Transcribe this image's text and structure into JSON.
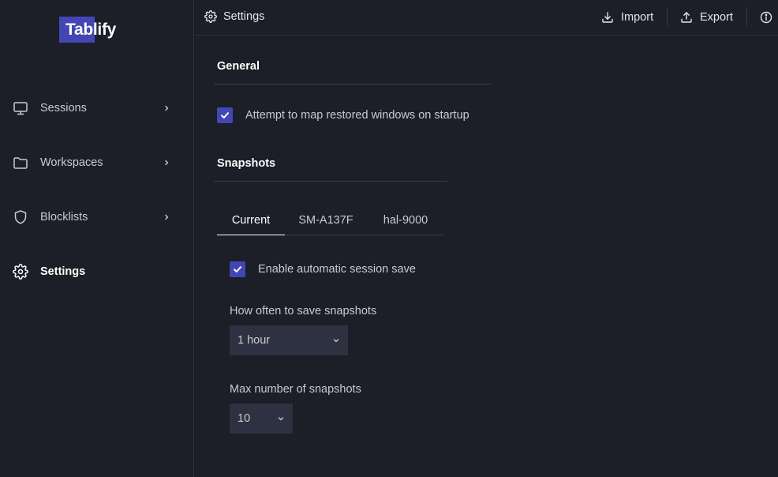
{
  "app": {
    "logo": "Tablify"
  },
  "sidebar": {
    "items": [
      {
        "label": "Sessions",
        "icon": "monitor-icon"
      },
      {
        "label": "Workspaces",
        "icon": "folder-icon"
      },
      {
        "label": "Blocklists",
        "icon": "shield-icon"
      },
      {
        "label": "Settings",
        "icon": "gear-icon",
        "active": true
      }
    ]
  },
  "header": {
    "title": "Settings",
    "import_label": "Import",
    "export_label": "Export"
  },
  "general": {
    "heading": "General",
    "map_windows": {
      "label": "Attempt to map restored windows on startup",
      "checked": true
    }
  },
  "snapshots": {
    "heading": "Snapshots",
    "tabs": [
      {
        "label": "Current",
        "active": true
      },
      {
        "label": "SM-A137F"
      },
      {
        "label": "hal-9000"
      }
    ],
    "auto_save": {
      "label": "Enable automatic session save",
      "checked": true
    },
    "frequency": {
      "label": "How often to save snapshots",
      "value": "1 hour"
    },
    "max": {
      "label": "Max number of snapshots",
      "value": "10"
    }
  },
  "colors": {
    "accent": "#4346b4",
    "background": "#1c1e28",
    "input": "#2e3140"
  }
}
